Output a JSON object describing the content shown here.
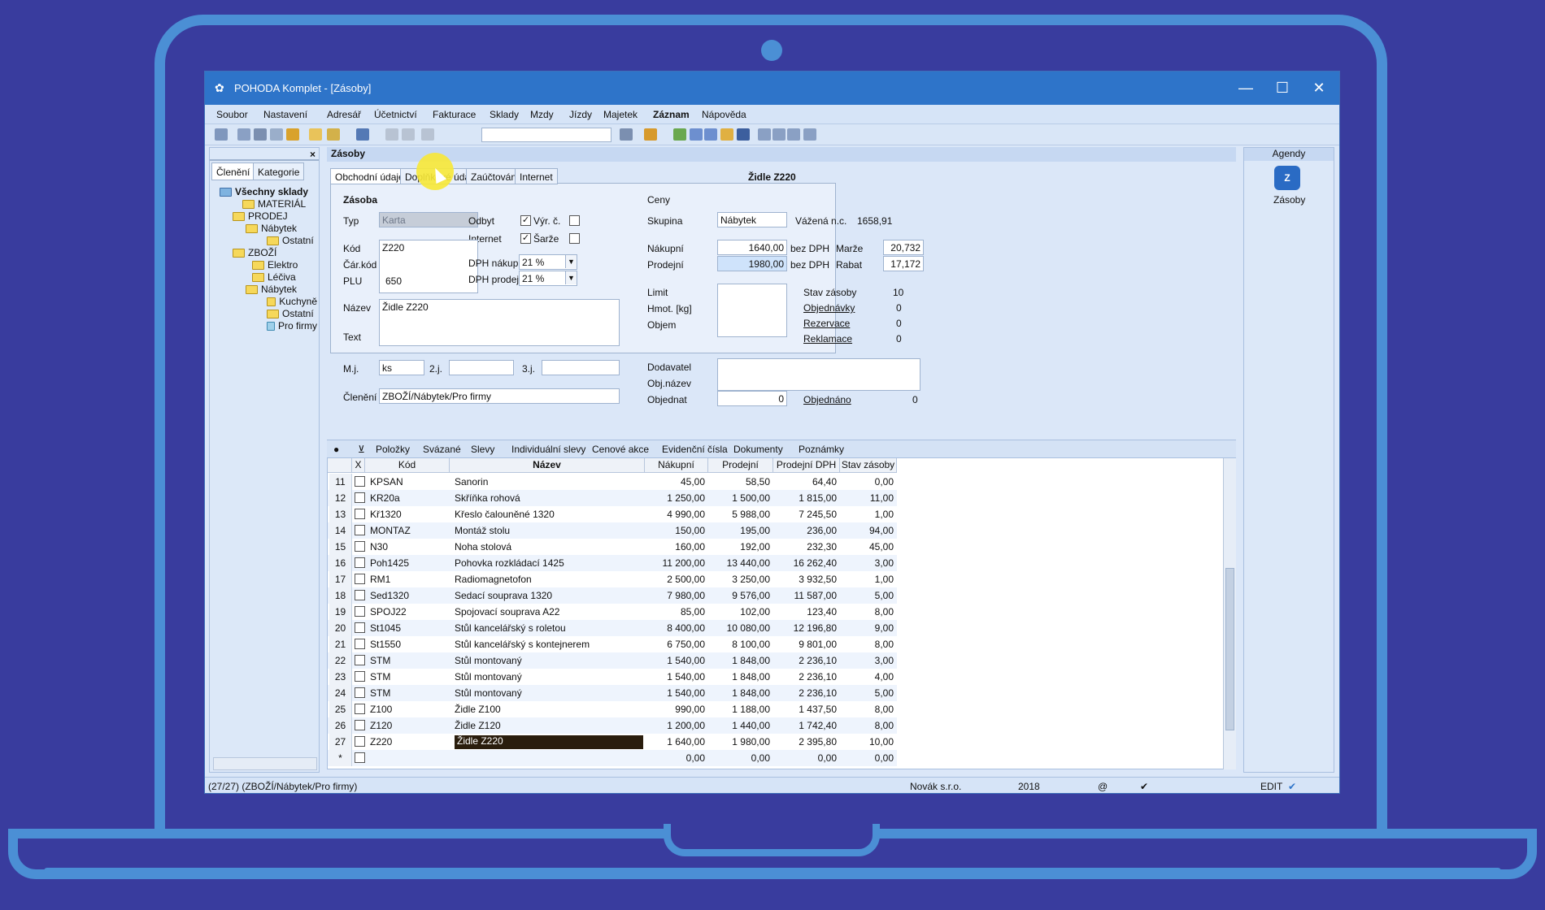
{
  "window": {
    "title": "POHODA Komplet - [Zásoby]",
    "minimize": "—",
    "maximize": "☐",
    "close": "✕"
  },
  "menu": [
    "Soubor",
    "Nastavení",
    "Adresář",
    "Účetnictví",
    "Fakturace",
    "Sklady",
    "Mzdy",
    "Jízdy",
    "Majetek",
    "Záznam",
    "Nápověda"
  ],
  "left_panel": {
    "close": "×",
    "tabs": [
      "Členění",
      "Kategorie"
    ],
    "tree": [
      "Všechny sklady",
      "MATERIÁL",
      "PRODEJ",
      "Nábytek",
      "Ostatní",
      "ZBOŽÍ",
      "Elektro",
      "Léčiva",
      "Nábytek",
      "Kuchyně",
      "Ostatní",
      "Pro firmy"
    ]
  },
  "main": {
    "header": "Zásoby",
    "tabs": [
      "Obchodní údaje",
      "Doplňkové údaje",
      "Zaúčtování",
      "Internet"
    ],
    "record_title": "Židle Z220",
    "form": {
      "section_zasoba": "Zásoba",
      "typ_label": "Typ",
      "typ_value": "Karta",
      "odbyt_label": "Odbyt",
      "vyr_label": "Výr. č.",
      "internet_label": "Internet",
      "sarze_label": "Šarže",
      "kod_label": "Kód",
      "kod_value": "Z220",
      "car_kod_label": "Čár.kód",
      "plu_label": "PLU",
      "plu_value": "650",
      "dph_nakup_label": "DPH nákup",
      "dph_nakup_value": "21 %",
      "dph_prodej_label": "DPH prodej",
      "dph_prodej_value": "21 %",
      "nazev_label": "Název",
      "nazev_value": "Židle Z220",
      "text_label": "Text",
      "mj_label": "M.j.",
      "mj_value": "ks",
      "mj2_label": "2.j.",
      "mj3_label": "3.j.",
      "cleneni_label": "Členění",
      "cleneni_value": "ZBOŽÍ/Nábytek/Pro firmy",
      "ceny_label": "Ceny",
      "skupina_label": "Skupina",
      "skupina_value": "Nábytek",
      "vazena_label": "Vážená n.c.",
      "vazena_value": "1658,91",
      "nakupni_label": "Nákupní",
      "nakupni_value": "1640,00",
      "bez_dph_1": "bez DPH",
      "marze_label": "Marže",
      "marze_value": "20,732",
      "prodejni_label": "Prodejní",
      "prodejni_value": "1980,00",
      "bez_dph_2": "bez DPH",
      "rabat_label": "Rabat",
      "rabat_value": "17,172",
      "limit_label": "Limit",
      "hmot_label": "Hmot. [kg]",
      "objem_label": "Objem",
      "stav_label": "Stav zásoby",
      "stav_value": "10",
      "objednavky_label": "Objednávky",
      "objednavky_value": "0",
      "rezervace_label": "Rezervace",
      "rezervace_value": "0",
      "reklamace_label": "Reklamace",
      "reklamace_value": "0",
      "dodavatel_label": "Dodavatel",
      "objnazev_label": "Obj.název",
      "objednat_label": "Objednat",
      "objednat_value": "0",
      "objednano_label": "Objednáno",
      "objednano_value": "0"
    },
    "grid_tabs": [
      "Položky",
      "Svázané",
      "Slevy",
      "Individuální slevy",
      "Cenové akce",
      "Evidenční čísla",
      "Dokumenty",
      "Poznámky"
    ],
    "grid_headers": [
      "X",
      "Kód",
      "Název",
      "Nákupní",
      "Prodejní",
      "Prodejní DPH",
      "Stav zásoby"
    ],
    "rows": [
      {
        "n": "11",
        "kod": "KPSAN",
        "nazev": "Sanorin",
        "nakup": "45,00",
        "prodej": "58,50",
        "dph": "64,40",
        "stav": "0,00"
      },
      {
        "n": "12",
        "kod": "KR20a",
        "nazev": "Skříňka rohová",
        "nakup": "1 250,00",
        "prodej": "1 500,00",
        "dph": "1 815,00",
        "stav": "11,00"
      },
      {
        "n": "13",
        "kod": "Kř1320",
        "nazev": "Křeslo čalouněné 1320",
        "nakup": "4 990,00",
        "prodej": "5 988,00",
        "dph": "7 245,50",
        "stav": "1,00"
      },
      {
        "n": "14",
        "kod": "MONTAZ",
        "nazev": "Montáž stolu",
        "nakup": "150,00",
        "prodej": "195,00",
        "dph": "236,00",
        "stav": "94,00"
      },
      {
        "n": "15",
        "kod": "N30",
        "nazev": "Noha stolová",
        "nakup": "160,00",
        "prodej": "192,00",
        "dph": "232,30",
        "stav": "45,00"
      },
      {
        "n": "16",
        "kod": "Poh1425",
        "nazev": "Pohovka rozkládací 1425",
        "nakup": "11 200,00",
        "prodej": "13 440,00",
        "dph": "16 262,40",
        "stav": "3,00"
      },
      {
        "n": "17",
        "kod": "RM1",
        "nazev": "Radiomagnetofon",
        "nakup": "2 500,00",
        "prodej": "3 250,00",
        "dph": "3 932,50",
        "stav": "1,00"
      },
      {
        "n": "18",
        "kod": "Sed1320",
        "nazev": "Sedací souprava 1320",
        "nakup": "7 980,00",
        "prodej": "9 576,00",
        "dph": "11 587,00",
        "stav": "5,00"
      },
      {
        "n": "19",
        "kod": "SPOJ22",
        "nazev": "Spojovací souprava A22",
        "nakup": "85,00",
        "prodej": "102,00",
        "dph": "123,40",
        "stav": "8,00"
      },
      {
        "n": "20",
        "kod": "St1045",
        "nazev": "Stůl kancelářský s roletou",
        "nakup": "8 400,00",
        "prodej": "10 080,00",
        "dph": "12 196,80",
        "stav": "9,00"
      },
      {
        "n": "21",
        "kod": "St1550",
        "nazev": "Stůl kancelářský s kontejnerem",
        "nakup": "6 750,00",
        "prodej": "8 100,00",
        "dph": "9 801,00",
        "stav": "8,00"
      },
      {
        "n": "22",
        "kod": "STM",
        "nazev": "Stůl montovaný",
        "nakup": "1 540,00",
        "prodej": "1 848,00",
        "dph": "2 236,10",
        "stav": "3,00"
      },
      {
        "n": "23",
        "kod": "STM",
        "nazev": "Stůl montovaný",
        "nakup": "1 540,00",
        "prodej": "1 848,00",
        "dph": "2 236,10",
        "stav": "4,00"
      },
      {
        "n": "24",
        "kod": "STM",
        "nazev": "Stůl montovaný",
        "nakup": "1 540,00",
        "prodej": "1 848,00",
        "dph": "2 236,10",
        "stav": "5,00"
      },
      {
        "n": "25",
        "kod": "Z100",
        "nazev": "Židle Z100",
        "nakup": "990,00",
        "prodej": "1 188,00",
        "dph": "1 437,50",
        "stav": "8,00"
      },
      {
        "n": "26",
        "kod": "Z120",
        "nazev": "Židle Z120",
        "nakup": "1 200,00",
        "prodej": "1 440,00",
        "dph": "1 742,40",
        "stav": "8,00"
      },
      {
        "n": "27",
        "kod": "Z220",
        "nazev": "Židle Z220",
        "nakup": "1 640,00",
        "prodej": "1 980,00",
        "dph": "2 395,80",
        "stav": "10,00"
      },
      {
        "n": "*",
        "kod": "",
        "nazev": "",
        "nakup": "0,00",
        "prodej": "0,00",
        "dph": "0,00",
        "stav": "0,00"
      }
    ]
  },
  "agendy": {
    "header": "Agendy",
    "item": "Zásoby"
  },
  "status": {
    "path": "(27/27) (ZBOŽÍ/Nábytek/Pro firmy)",
    "company": "Novák s.r.o.",
    "year": "2018",
    "at": "@",
    "mode": "EDIT"
  },
  "colors": {
    "accent": "#2e74c9",
    "background": "#393c9e",
    "laptop": "#4b8fd5",
    "selected": "#2a1d0d"
  }
}
